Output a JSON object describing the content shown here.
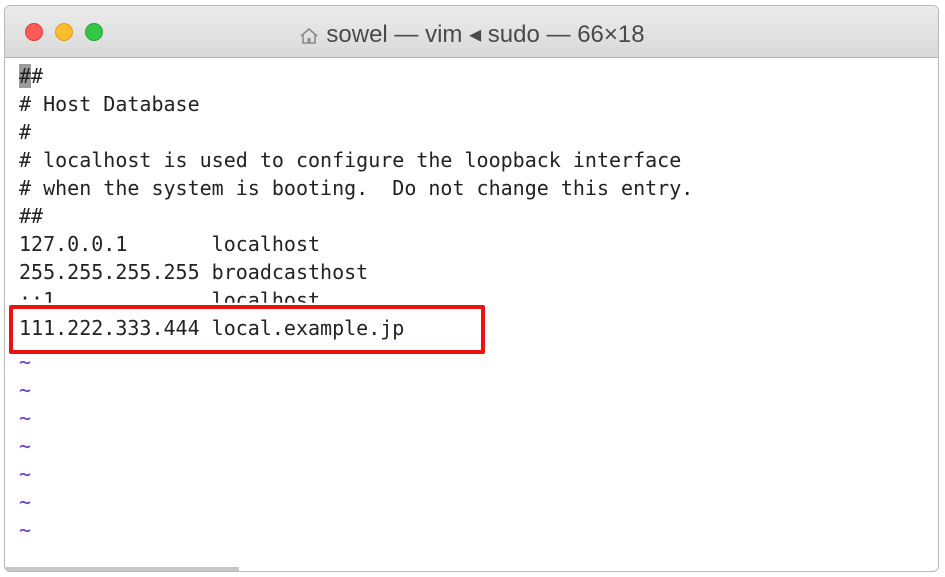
{
  "window": {
    "title": "sowel — vim ◂ sudo — 66×18",
    "icon": "home-folder-icon"
  },
  "editor": {
    "cursor_char": "#",
    "first_line_rest": "#",
    "lines": [
      "# Host Database",
      "#",
      "# localhost is used to configure the loopback interface",
      "# when the system is booting.  Do not change this entry.",
      "##",
      "127.0.0.1       localhost",
      "255.255.255.255 broadcasthost",
      "::1             localhost",
      "111.222.333.444 local.example.jp"
    ],
    "tilde": "~"
  },
  "annotation": {
    "highlight_color": "#ee1111"
  }
}
